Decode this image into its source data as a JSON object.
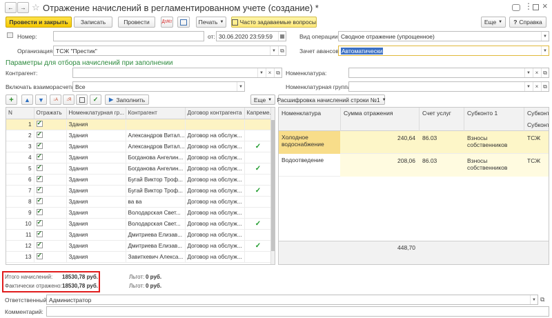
{
  "header": {
    "title": "Отражение начислений в регламентированном учете (создание) *",
    "back_icon": "←",
    "forward_icon": "→",
    "star_icon": "☆"
  },
  "toolbar": {
    "post_close": "Провести и закрыть",
    "write": "Записать",
    "post": "Провести",
    "dtkt": "Дт/Кт",
    "print": "Печать",
    "faq": "Часто задаваемые вопросы",
    "more": "Еще",
    "help": "Справка",
    "help_mark": "?"
  },
  "form": {
    "number_label": "Номер:",
    "number_value": "",
    "date_label": "от:",
    "date_value": "30.06.2020 23:59:59",
    "op_label": "Вид операции:",
    "op_value": "Сводное отражение (упрощенное)",
    "org_label": "Организация:",
    "org_value": "ТСЖ \"Престик\"",
    "advance_label": "Зачет авансов:",
    "advance_value": "Автоматически",
    "section_title": "Параметры для отбора начислений при заполнении",
    "contractor_label": "Контрагент:",
    "contractor_value": "",
    "nomen_label": "Номенклатура:",
    "nomen_value": "",
    "mutual_label": "Включать взаиморасчеты:",
    "mutual_value": "Все",
    "nomen_group_label": "Номенклатурная группа:",
    "nomen_group_value": ""
  },
  "left_toolbar": {
    "fill": "Заполнить",
    "more": "Еще"
  },
  "left_table": {
    "columns": [
      "N",
      "Отражать",
      "Номенклатурная гр...",
      "Контрагент",
      "Договор контрагента",
      "Капреме..."
    ],
    "rows": [
      {
        "n": "1",
        "reflect": true,
        "group": "Здания",
        "contractor": "",
        "contract": "",
        "cap": false
      },
      {
        "n": "2",
        "reflect": true,
        "group": "Здания",
        "contractor": "Александров Витал...",
        "contract": "Договор на обслуж...",
        "cap": false
      },
      {
        "n": "3",
        "reflect": true,
        "group": "Здания",
        "contractor": "Александров Витал...",
        "contract": "Договор на обслуж...",
        "cap": true
      },
      {
        "n": "4",
        "reflect": true,
        "group": "Здания",
        "contractor": "Богданова Ангелин...",
        "contract": "Договор на обслуж...",
        "cap": false
      },
      {
        "n": "5",
        "reflect": true,
        "group": "Здания",
        "contractor": "Богданова Ангелин...",
        "contract": "Договор на обслуж...",
        "cap": true
      },
      {
        "n": "6",
        "reflect": true,
        "group": "Здания",
        "contractor": "Бугай Виктор Троф...",
        "contract": "Договор на обслуж...",
        "cap": false
      },
      {
        "n": "7",
        "reflect": true,
        "group": "Здания",
        "contractor": "Бугай Виктор Троф...",
        "contract": "Договор на обслуж...",
        "cap": true
      },
      {
        "n": "8",
        "reflect": true,
        "group": "Здания",
        "contractor": "ва ва",
        "contract": "Договор на обслуж...",
        "cap": false
      },
      {
        "n": "9",
        "reflect": true,
        "group": "Здания",
        "contractor": "Володарская Свет...",
        "contract": "Договор на обслуж...",
        "cap": false
      },
      {
        "n": "10",
        "reflect": true,
        "group": "Здания",
        "contractor": "Володарская Свет...",
        "contract": "Договор на обслуж...",
        "cap": true
      },
      {
        "n": "11",
        "reflect": true,
        "group": "Здания",
        "contractor": "Дмитриева Елизав...",
        "contract": "Договор на обслуж...",
        "cap": false
      },
      {
        "n": "12",
        "reflect": true,
        "group": "Здания",
        "contractor": "Дмитриева Елизав...",
        "contract": "Договор на обслуж...",
        "cap": true
      },
      {
        "n": "13",
        "reflect": true,
        "group": "Здания",
        "contractor": "Завиткевич Алекса...",
        "contract": "Договор на обслуж...",
        "cap": false
      }
    ]
  },
  "right_panel": {
    "decode_button": "Расшифровка начислений строки №1",
    "columns": [
      "Номенклатура",
      "Сумма отражения",
      "Счет услуг",
      "Субконто 1",
      "Субконто"
    ],
    "subheader": "Субконто",
    "rows": [
      {
        "nomen": "Холодное водоснабжение",
        "sum": "240,64",
        "account": "86.03",
        "sub1": "Взносы собственников",
        "sub2": "ТСЖ"
      },
      {
        "nomen": "Водоотведение",
        "sum": "208,06",
        "account": "86.03",
        "sub1": "Взносы собственников",
        "sub2": "ТСЖ"
      }
    ],
    "total": "448,70"
  },
  "totals": {
    "accrued_label": "Итого начислений:",
    "accrued_value": "18530,78 руб.",
    "reflected_label": "Фактически отражено:",
    "reflected_value": "18530,78 руб.",
    "benefits1_label": "Льгот:",
    "benefits1_value": "0 руб.",
    "benefits2_label": "Льгот:",
    "benefits2_value": "0 руб."
  },
  "footer": {
    "responsible_label": "Ответственный:",
    "responsible_value": "Администратор",
    "comment_label": "Комментарий:",
    "comment_value": ""
  }
}
